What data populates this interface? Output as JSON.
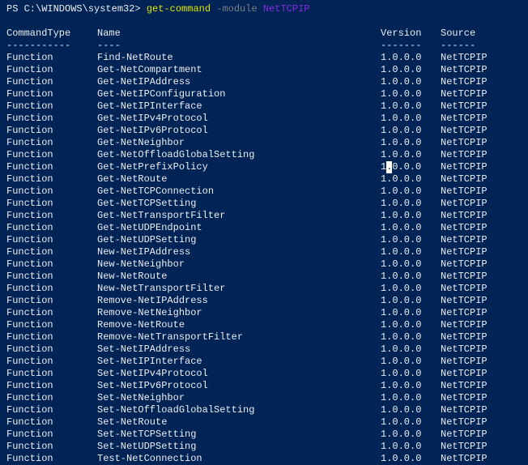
{
  "prompt": "PS C:\\WINDOWS\\system32> ",
  "command": "get-command",
  "param": " -module ",
  "arg": "NetTCPIP",
  "headers": [
    "CommandType",
    "Name",
    "Version",
    "Source"
  ],
  "dashes": [
    "-----------",
    "----",
    "-------",
    "------"
  ],
  "rows": [
    {
      "type": "Function",
      "name": "Find-NetRoute",
      "version": "1.0.0.0",
      "source": "NetTCPIP"
    },
    {
      "type": "Function",
      "name": "Get-NetCompartment",
      "version": "1.0.0.0",
      "source": "NetTCPIP"
    },
    {
      "type": "Function",
      "name": "Get-NetIPAddress",
      "version": "1.0.0.0",
      "source": "NetTCPIP"
    },
    {
      "type": "Function",
      "name": "Get-NetIPConfiguration",
      "version": "1.0.0.0",
      "source": "NetTCPIP"
    },
    {
      "type": "Function",
      "name": "Get-NetIPInterface",
      "version": "1.0.0.0",
      "source": "NetTCPIP"
    },
    {
      "type": "Function",
      "name": "Get-NetIPv4Protocol",
      "version": "1.0.0.0",
      "source": "NetTCPIP"
    },
    {
      "type": "Function",
      "name": "Get-NetIPv6Protocol",
      "version": "1.0.0.0",
      "source": "NetTCPIP"
    },
    {
      "type": "Function",
      "name": "Get-NetNeighbor",
      "version": "1.0.0.0",
      "source": "NetTCPIP"
    },
    {
      "type": "Function",
      "name": "Get-NetOffloadGlobalSetting",
      "version": "1.0.0.0",
      "source": "NetTCPIP"
    },
    {
      "type": "Function",
      "name": "Get-NetPrefixPolicy",
      "version": "1.0.0.0",
      "source": "NetTCPIP",
      "cursor": true
    },
    {
      "type": "Function",
      "name": "Get-NetRoute",
      "version": "1.0.0.0",
      "source": "NetTCPIP"
    },
    {
      "type": "Function",
      "name": "Get-NetTCPConnection",
      "version": "1.0.0.0",
      "source": "NetTCPIP"
    },
    {
      "type": "Function",
      "name": "Get-NetTCPSetting",
      "version": "1.0.0.0",
      "source": "NetTCPIP"
    },
    {
      "type": "Function",
      "name": "Get-NetTransportFilter",
      "version": "1.0.0.0",
      "source": "NetTCPIP"
    },
    {
      "type": "Function",
      "name": "Get-NetUDPEndpoint",
      "version": "1.0.0.0",
      "source": "NetTCPIP"
    },
    {
      "type": "Function",
      "name": "Get-NetUDPSetting",
      "version": "1.0.0.0",
      "source": "NetTCPIP"
    },
    {
      "type": "Function",
      "name": "New-NetIPAddress",
      "version": "1.0.0.0",
      "source": "NetTCPIP"
    },
    {
      "type": "Function",
      "name": "New-NetNeighbor",
      "version": "1.0.0.0",
      "source": "NetTCPIP"
    },
    {
      "type": "Function",
      "name": "New-NetRoute",
      "version": "1.0.0.0",
      "source": "NetTCPIP"
    },
    {
      "type": "Function",
      "name": "New-NetTransportFilter",
      "version": "1.0.0.0",
      "source": "NetTCPIP"
    },
    {
      "type": "Function",
      "name": "Remove-NetIPAddress",
      "version": "1.0.0.0",
      "source": "NetTCPIP"
    },
    {
      "type": "Function",
      "name": "Remove-NetNeighbor",
      "version": "1.0.0.0",
      "source": "NetTCPIP"
    },
    {
      "type": "Function",
      "name": "Remove-NetRoute",
      "version": "1.0.0.0",
      "source": "NetTCPIP"
    },
    {
      "type": "Function",
      "name": "Remove-NetTransportFilter",
      "version": "1.0.0.0",
      "source": "NetTCPIP"
    },
    {
      "type": "Function",
      "name": "Set-NetIPAddress",
      "version": "1.0.0.0",
      "source": "NetTCPIP"
    },
    {
      "type": "Function",
      "name": "Set-NetIPInterface",
      "version": "1.0.0.0",
      "source": "NetTCPIP"
    },
    {
      "type": "Function",
      "name": "Set-NetIPv4Protocol",
      "version": "1.0.0.0",
      "source": "NetTCPIP"
    },
    {
      "type": "Function",
      "name": "Set-NetIPv6Protocol",
      "version": "1.0.0.0",
      "source": "NetTCPIP"
    },
    {
      "type": "Function",
      "name": "Set-NetNeighbor",
      "version": "1.0.0.0",
      "source": "NetTCPIP"
    },
    {
      "type": "Function",
      "name": "Set-NetOffloadGlobalSetting",
      "version": "1.0.0.0",
      "source": "NetTCPIP"
    },
    {
      "type": "Function",
      "name": "Set-NetRoute",
      "version": "1.0.0.0",
      "source": "NetTCPIP"
    },
    {
      "type": "Function",
      "name": "Set-NetTCPSetting",
      "version": "1.0.0.0",
      "source": "NetTCPIP"
    },
    {
      "type": "Function",
      "name": "Set-NetUDPSetting",
      "version": "1.0.0.0",
      "source": "NetTCPIP"
    },
    {
      "type": "Function",
      "name": "Test-NetConnection",
      "version": "1.0.0.0",
      "source": "NetTCPIP"
    }
  ]
}
